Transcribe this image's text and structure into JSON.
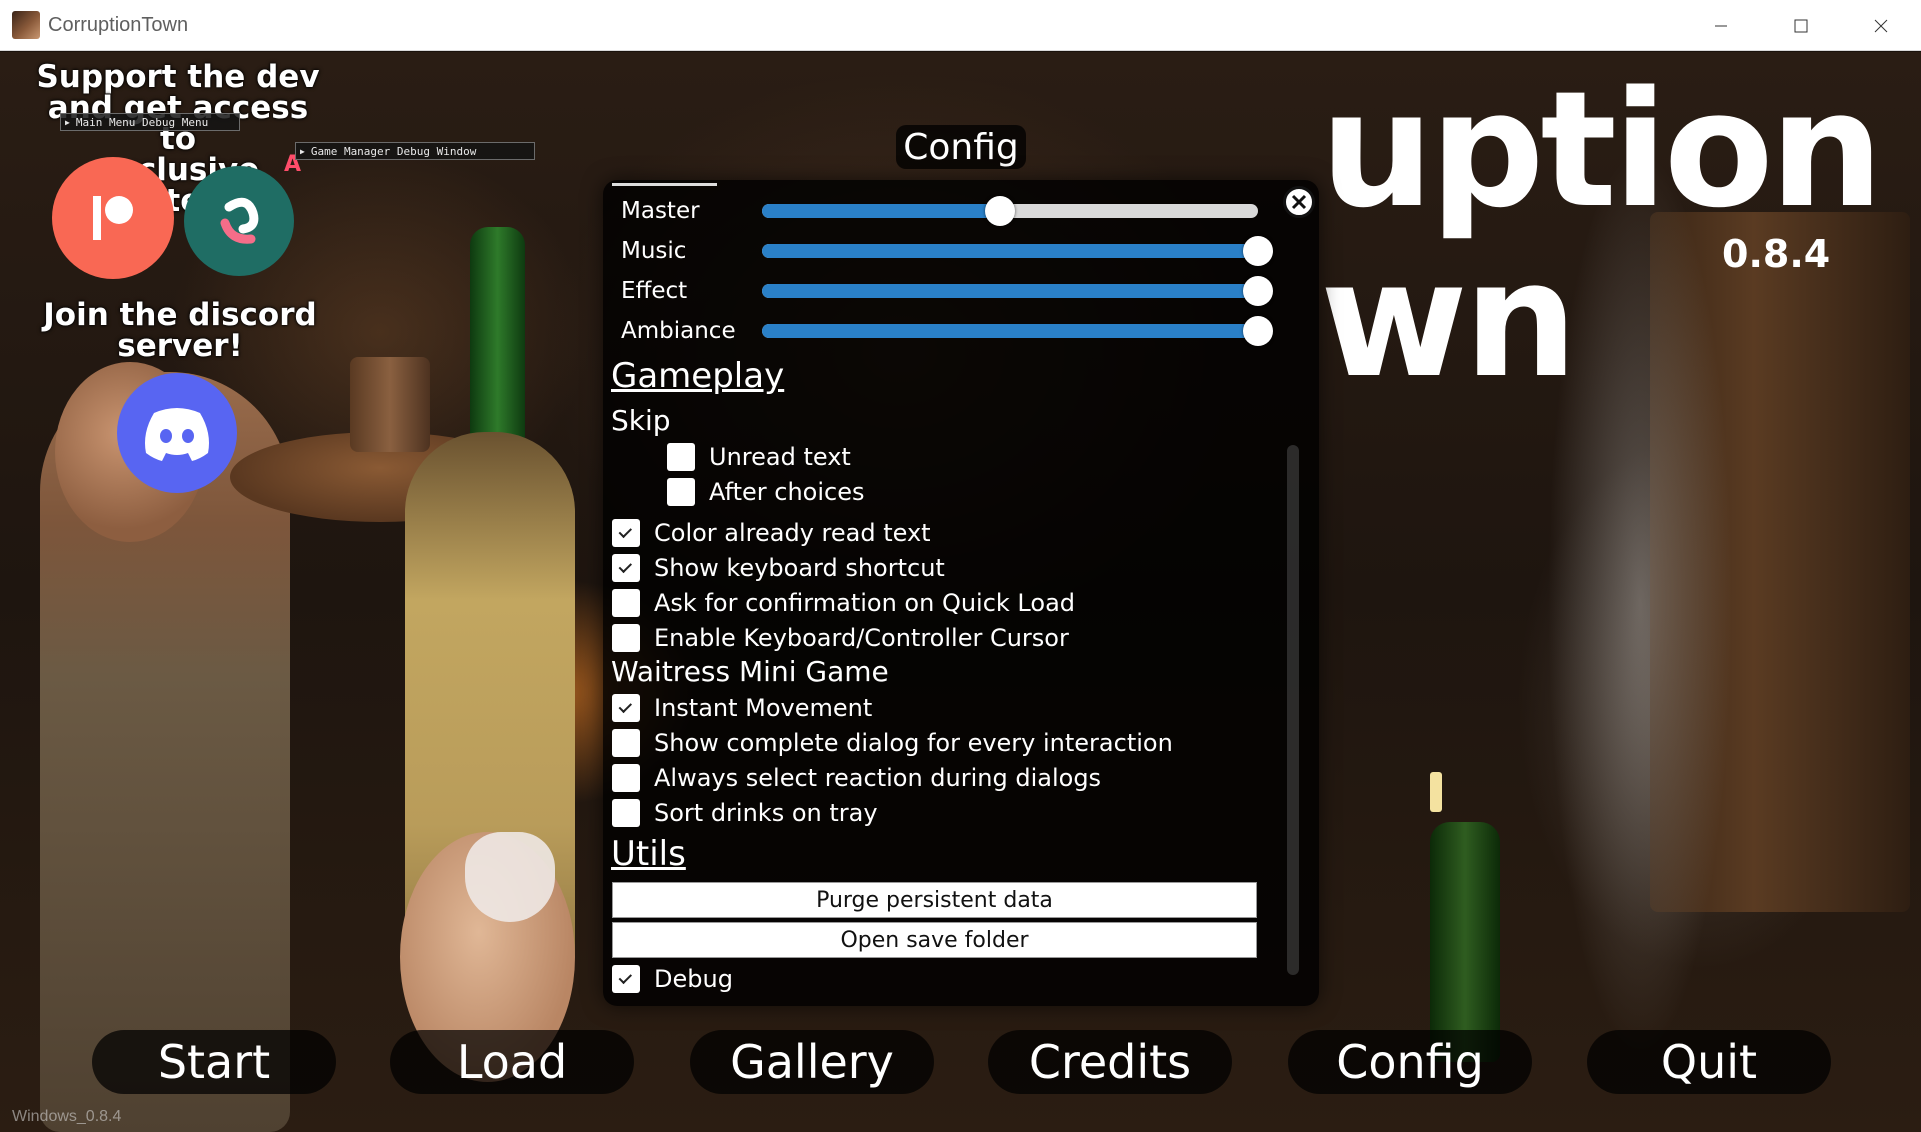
{
  "window": {
    "title": "CorruptionTown"
  },
  "logo": {
    "line1": "uption",
    "line2": "wn",
    "version": "0.8.4"
  },
  "promo": {
    "support_lines": [
      "Support the dev",
      "and get access to",
      "exclusive content!"
    ],
    "discord_lines": [
      "Join the discord",
      "server!"
    ],
    "letter_badge": "A"
  },
  "debug": {
    "main_menu": "Main Menu Debug Menu",
    "game_manager": "Game Manager Debug Window"
  },
  "config": {
    "title": "Config",
    "audio": [
      {
        "label": "Master",
        "value": 0.48
      },
      {
        "label": "Music",
        "value": 1.0
      },
      {
        "label": "Effect",
        "value": 1.0
      },
      {
        "label": "Ambiance",
        "value": 1.0
      }
    ],
    "gameplay_heading": "Gameplay",
    "skip_heading": "Skip",
    "skip_options": [
      {
        "label": "Unread text",
        "checked": false
      },
      {
        "label": "After choices",
        "checked": false
      }
    ],
    "gameplay_options": [
      {
        "label": "Color already read text",
        "checked": true
      },
      {
        "label": "Show keyboard shortcut",
        "checked": true
      },
      {
        "label": "Ask for confirmation on Quick Load",
        "checked": false
      },
      {
        "label": "Enable Keyboard/Controller Cursor",
        "checked": false
      }
    ],
    "waitress_heading": "Waitress Mini Game",
    "waitress_options": [
      {
        "label": "Instant Movement",
        "checked": true
      },
      {
        "label": "Show complete dialog for every interaction",
        "checked": false
      },
      {
        "label": "Always select reaction during dialogs",
        "checked": false
      },
      {
        "label": "Sort drinks on tray",
        "checked": false
      }
    ],
    "utils_heading": "Utils",
    "purge_label": "Purge persistent data",
    "open_folder_label": "Open save folder",
    "debug_option": {
      "label": "Debug",
      "checked": true
    }
  },
  "menu": {
    "start": "Start",
    "load": "Load",
    "gallery": "Gallery",
    "credits": "Credits",
    "config": "Config",
    "quit": "Quit"
  },
  "build": "Windows_0.8.4"
}
